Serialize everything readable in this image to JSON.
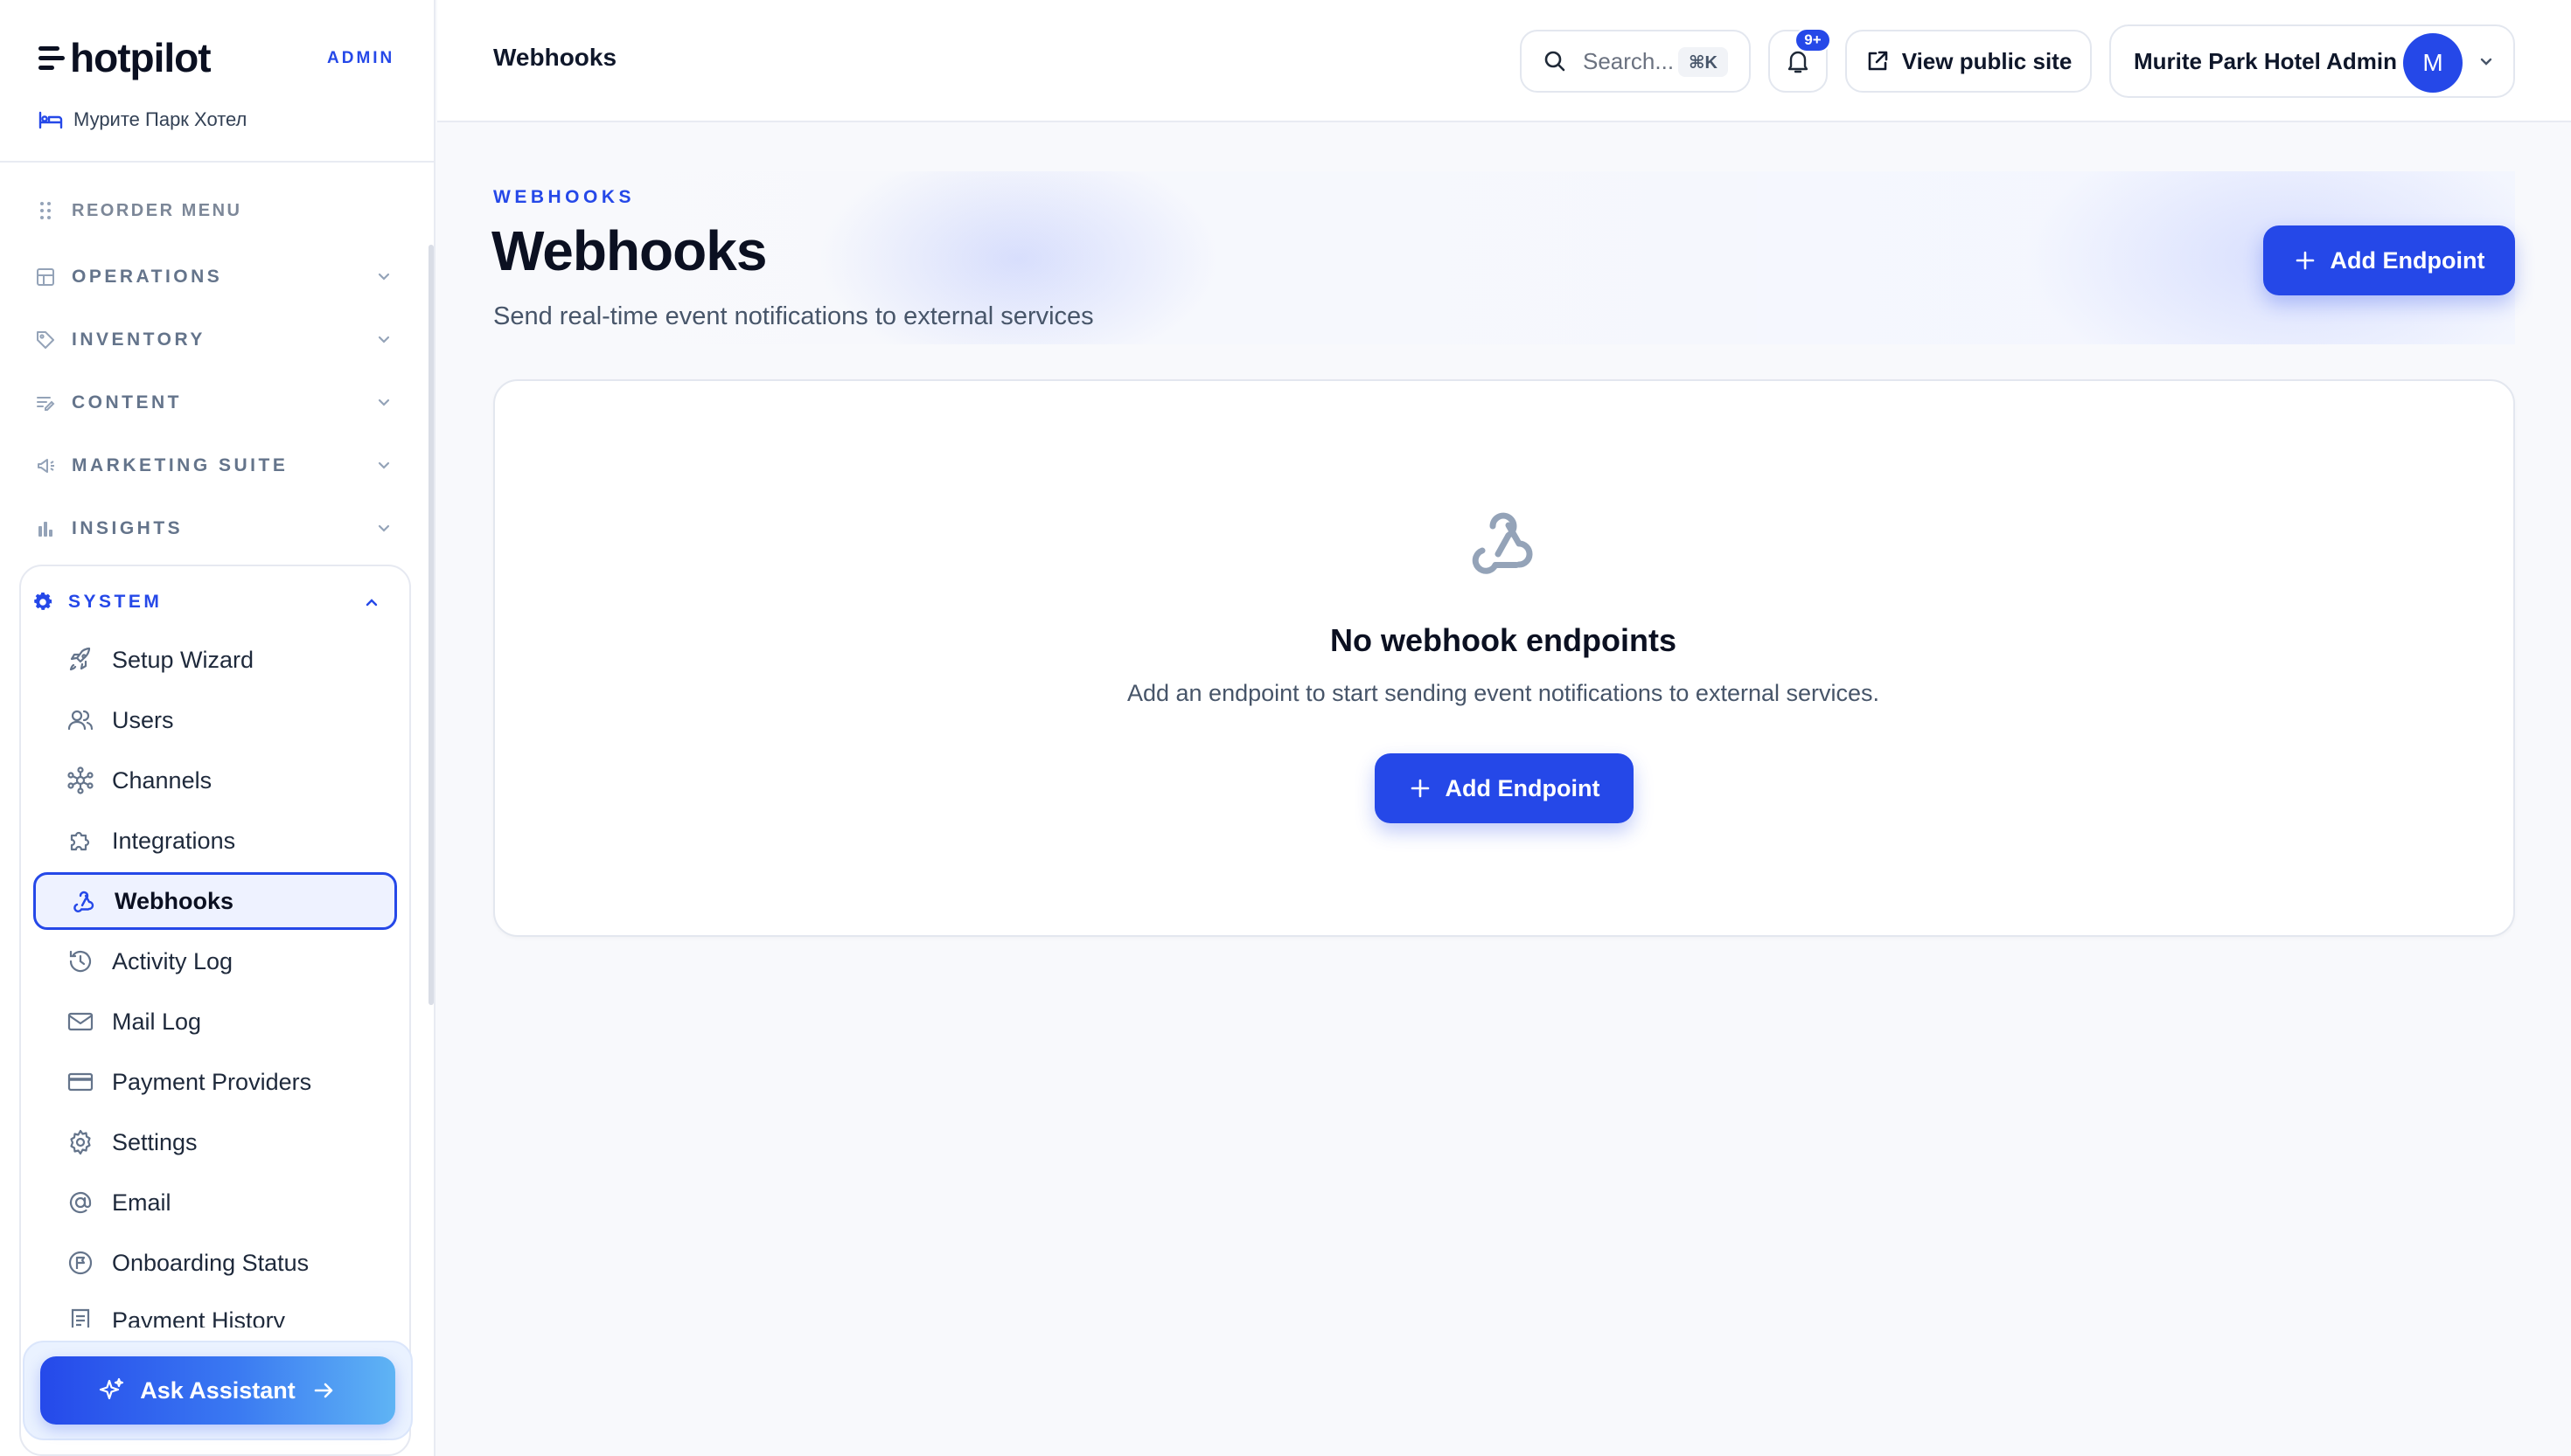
{
  "brand": {
    "name": "hotpilot",
    "tag": "ADMIN",
    "hotel": "Мурите Парк Хотел"
  },
  "sidebar": {
    "reorder_label": "REORDER MENU",
    "sections": [
      {
        "label": "OPERATIONS",
        "icon": "layout-icon"
      },
      {
        "label": "INVENTORY",
        "icon": "tag-icon"
      },
      {
        "label": "CONTENT",
        "icon": "content-icon"
      },
      {
        "label": "MARKETING SUITE",
        "icon": "megaphone-icon"
      },
      {
        "label": "INSIGHTS",
        "icon": "bar-chart-icon"
      }
    ],
    "system": {
      "label": "SYSTEM",
      "items": [
        {
          "label": "Setup Wizard",
          "icon": "rocket-icon"
        },
        {
          "label": "Users",
          "icon": "users-icon"
        },
        {
          "label": "Channels",
          "icon": "network-icon"
        },
        {
          "label": "Integrations",
          "icon": "puzzle-icon"
        },
        {
          "label": "Webhooks",
          "icon": "webhook-icon",
          "active": true
        },
        {
          "label": "Activity Log",
          "icon": "history-icon"
        },
        {
          "label": "Mail Log",
          "icon": "mail-icon"
        },
        {
          "label": "Payment Providers",
          "icon": "credit-card-icon"
        },
        {
          "label": "Settings",
          "icon": "gear-icon"
        },
        {
          "label": "Email",
          "icon": "at-sign-icon"
        },
        {
          "label": "Onboarding Status",
          "icon": "flag-circle-icon"
        },
        {
          "label": "Payment History",
          "icon": "receipt-icon"
        }
      ]
    },
    "assistant_label": "Ask Assistant"
  },
  "topbar": {
    "title": "Webhooks",
    "search_placeholder": "Search...",
    "search_shortcut": "⌘K",
    "notifications_badge": "9+",
    "view_site_label": "View public site",
    "user_name": "Murite Park Hotel Admin",
    "avatar_initial": "M"
  },
  "hero": {
    "eyebrow": "WEBHOOKS",
    "title": "Webhooks",
    "subtitle": "Send real-time event notifications to external services",
    "add_button": "Add Endpoint"
  },
  "empty_state": {
    "title": "No webhook endpoints",
    "description": "Add an endpoint to start sending event notifications to external services.",
    "add_button": "Add Endpoint"
  },
  "colors": {
    "accent": "#2548e8",
    "text": "#0b1021",
    "muted": "#64748b",
    "background": "#f8f9fc"
  }
}
